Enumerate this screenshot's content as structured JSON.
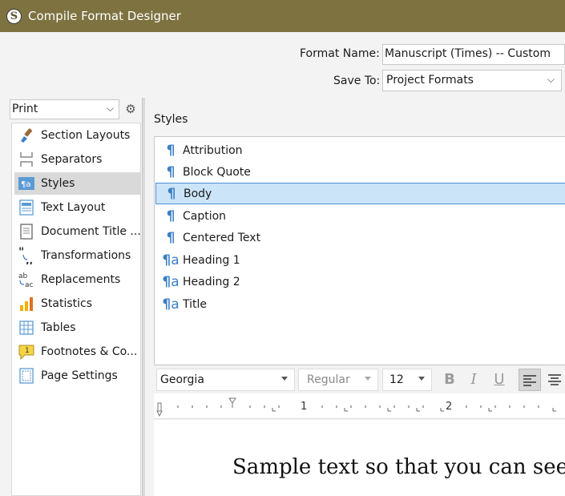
{
  "window": {
    "title": "Compile Format Designer",
    "logo_letter": "S"
  },
  "header": {
    "format_name_label": "Format Name:",
    "format_name_value": "Manuscript (Times) -- Custom",
    "save_to_label": "Save To:",
    "save_to_value": "Project Formats"
  },
  "sidebar": {
    "output_type": "Print",
    "items": [
      {
        "label": "Section Layouts",
        "icon": "paintbrush-icon"
      },
      {
        "label": "Separators",
        "icon": "separator-icon"
      },
      {
        "label": "Styles",
        "icon": "styles-icon",
        "selected": true
      },
      {
        "label": "Text Layout",
        "icon": "text-layout-icon"
      },
      {
        "label": "Document Title ...",
        "icon": "document-icon"
      },
      {
        "label": "Transformations",
        "icon": "quotes-icon"
      },
      {
        "label": "Replacements",
        "icon": "replace-icon"
      },
      {
        "label": "Statistics",
        "icon": "bar-chart-icon"
      },
      {
        "label": "Tables",
        "icon": "table-icon"
      },
      {
        "label": "Footnotes & Co...",
        "icon": "footnote-icon"
      },
      {
        "label": "Page Settings",
        "icon": "page-icon"
      }
    ]
  },
  "styles": {
    "heading": "Styles",
    "items": [
      {
        "label": "Attribution",
        "kind": "paragraph"
      },
      {
        "label": "Block Quote",
        "kind": "paragraph"
      },
      {
        "label": "Body",
        "kind": "paragraph",
        "selected": true
      },
      {
        "label": "Caption",
        "kind": "paragraph"
      },
      {
        "label": "Centered Text",
        "kind": "paragraph"
      },
      {
        "label": "Heading 1",
        "kind": "paragraph-character"
      },
      {
        "label": "Heading 2",
        "kind": "paragraph-character"
      },
      {
        "label": "Title",
        "kind": "paragraph-character"
      }
    ]
  },
  "format_bar": {
    "font": "Georgia",
    "weight": "Regular",
    "size": "12",
    "bold": "B",
    "italic": "I",
    "underline": "U"
  },
  "ruler": {
    "labels": [
      "1",
      "2"
    ]
  },
  "preview": {
    "text": "Sample text so that you can see"
  },
  "colors": {
    "titlebar": "#7d7240",
    "accent": "#3b7fc4",
    "selection": "#cce4f7"
  }
}
